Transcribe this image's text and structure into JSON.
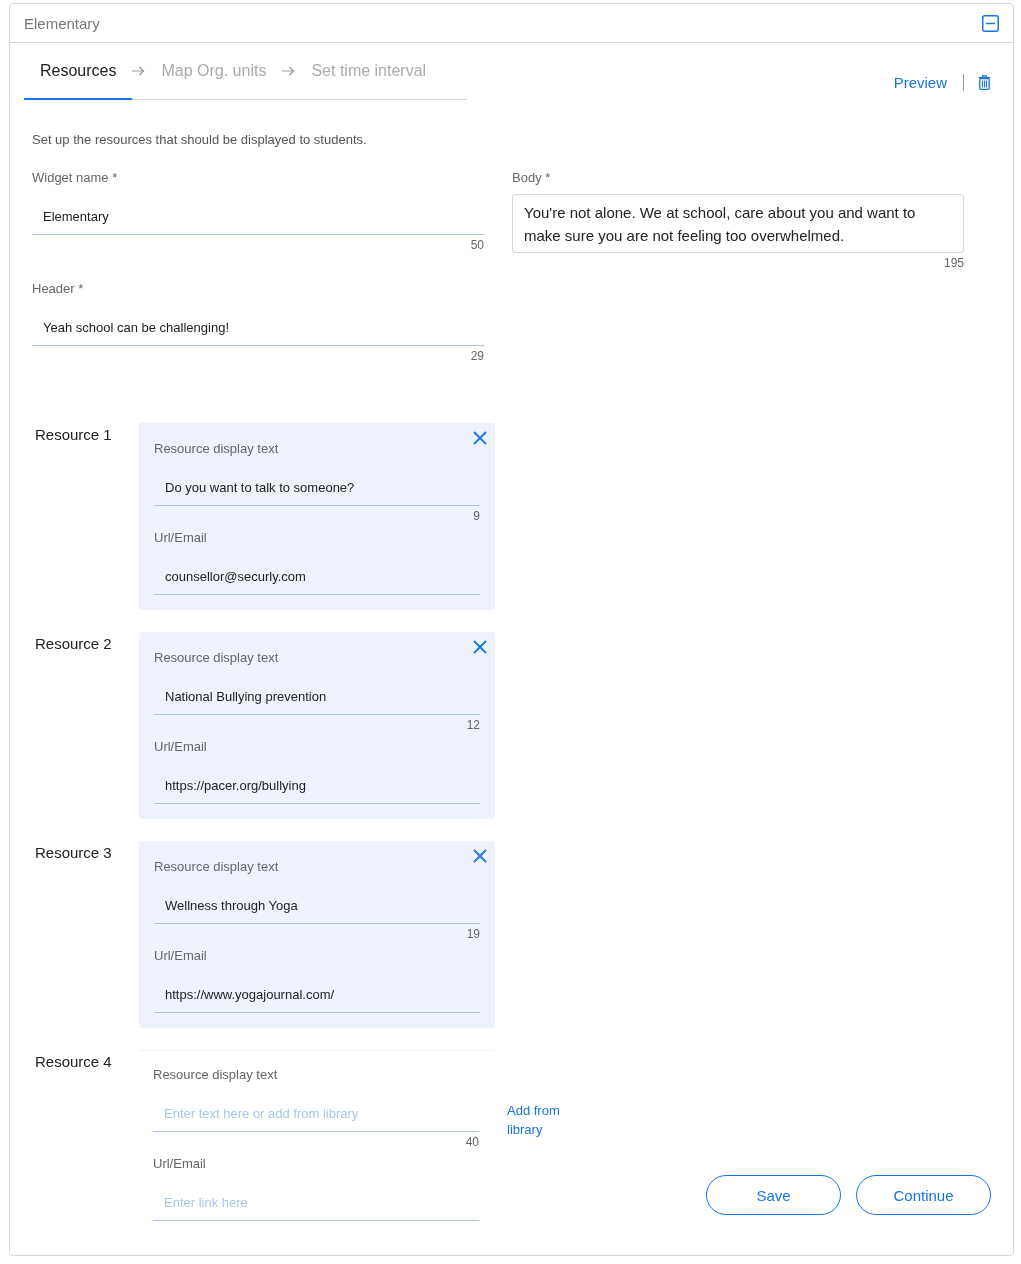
{
  "panel": {
    "title": "Elementary",
    "expanded": true
  },
  "tabs": [
    {
      "label": "Resources",
      "selected": true
    },
    {
      "label": "Map Org. units",
      "selected": false
    },
    {
      "label": "Set time interval",
      "selected": false
    }
  ],
  "actions": {
    "preview": "Preview"
  },
  "intro": "Set up the resources that should be displayed to students.",
  "fields": {
    "widget_name": {
      "label": "Widget name *",
      "value": "Elementary",
      "counter": "50"
    },
    "header": {
      "label": "Header *",
      "value": "Yeah school can be challenging!",
      "counter": "29"
    },
    "body": {
      "label": "Body *",
      "value": "You're not alone. We at school, care about you and want to make sure you are not feeling too overwhelmed.",
      "counter": "195"
    }
  },
  "resources": [
    {
      "title": "Resource 1",
      "removable": true,
      "display_label": "Resource display text",
      "display_value": "Do you want to talk to someone?",
      "counter": "9",
      "url_label": "Url/Email",
      "url_value": "counsellor@securly.com"
    },
    {
      "title": "Resource 2",
      "removable": true,
      "display_label": "Resource display text",
      "display_value": "National Bullying prevention",
      "counter": "12",
      "url_label": "Url/Email",
      "url_value": "https://pacer.org/bullying"
    },
    {
      "title": "Resource 3",
      "removable": true,
      "display_label": "Resource display text",
      "display_value": "Wellness through Yoga",
      "counter": "19",
      "url_label": "Url/Email",
      "url_value": "https://www.yogajournal.com/"
    },
    {
      "title": "Resource 4",
      "removable": false,
      "display_label": "Resource display text",
      "display_placeholder": "Enter text here or add from library",
      "counter": "40",
      "url_label": "Url/Email",
      "url_placeholder": "Enter link here",
      "add_link": "Add from library"
    }
  ],
  "buttons": [
    {
      "label": "Save"
    },
    {
      "label": "Continue"
    }
  ]
}
